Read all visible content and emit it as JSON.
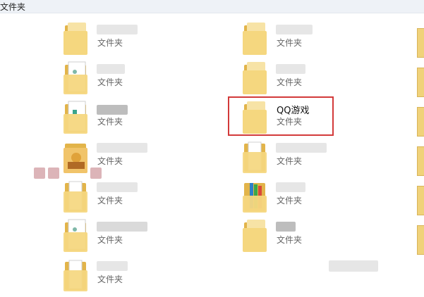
{
  "window": {
    "header_label": "文件夹"
  },
  "colors": {
    "folder": "#f5d77f",
    "folder_dark": "#e2b44a",
    "highlight": "#d33a3a"
  },
  "left_column": [
    {
      "name": "",
      "type": "文件夹",
      "icon": "folder-icon"
    },
    {
      "name": "",
      "type": "文件夹",
      "icon": "folder-with-document-icon"
    },
    {
      "name": "",
      "type": "文件夹",
      "icon": "folder-with-document-icon"
    },
    {
      "name": "",
      "type": "文件夹",
      "icon": "folder-with-app-icon"
    },
    {
      "name": "",
      "type": "文件夹",
      "icon": "folder-with-paper-icon"
    },
    {
      "name": "",
      "type": "文件夹",
      "icon": "folder-with-document-icon"
    },
    {
      "name": "",
      "type": "文件夹",
      "icon": "folder-with-paper-icon"
    }
  ],
  "right_column": [
    {
      "name": "",
      "type": "文件夹",
      "icon": "folder-icon"
    },
    {
      "name": "",
      "type": "文件夹",
      "icon": "folder-icon"
    },
    {
      "name": "QQ游戏",
      "type": "文件夹",
      "icon": "folder-icon",
      "highlighted": true
    },
    {
      "name": "",
      "type": "文件夹",
      "icon": "folder-with-paper-icon"
    },
    {
      "name": "",
      "type": "文件夹",
      "icon": "folder-with-books-icon"
    },
    {
      "name": "",
      "type": "文件夹",
      "icon": "folder-icon"
    }
  ]
}
